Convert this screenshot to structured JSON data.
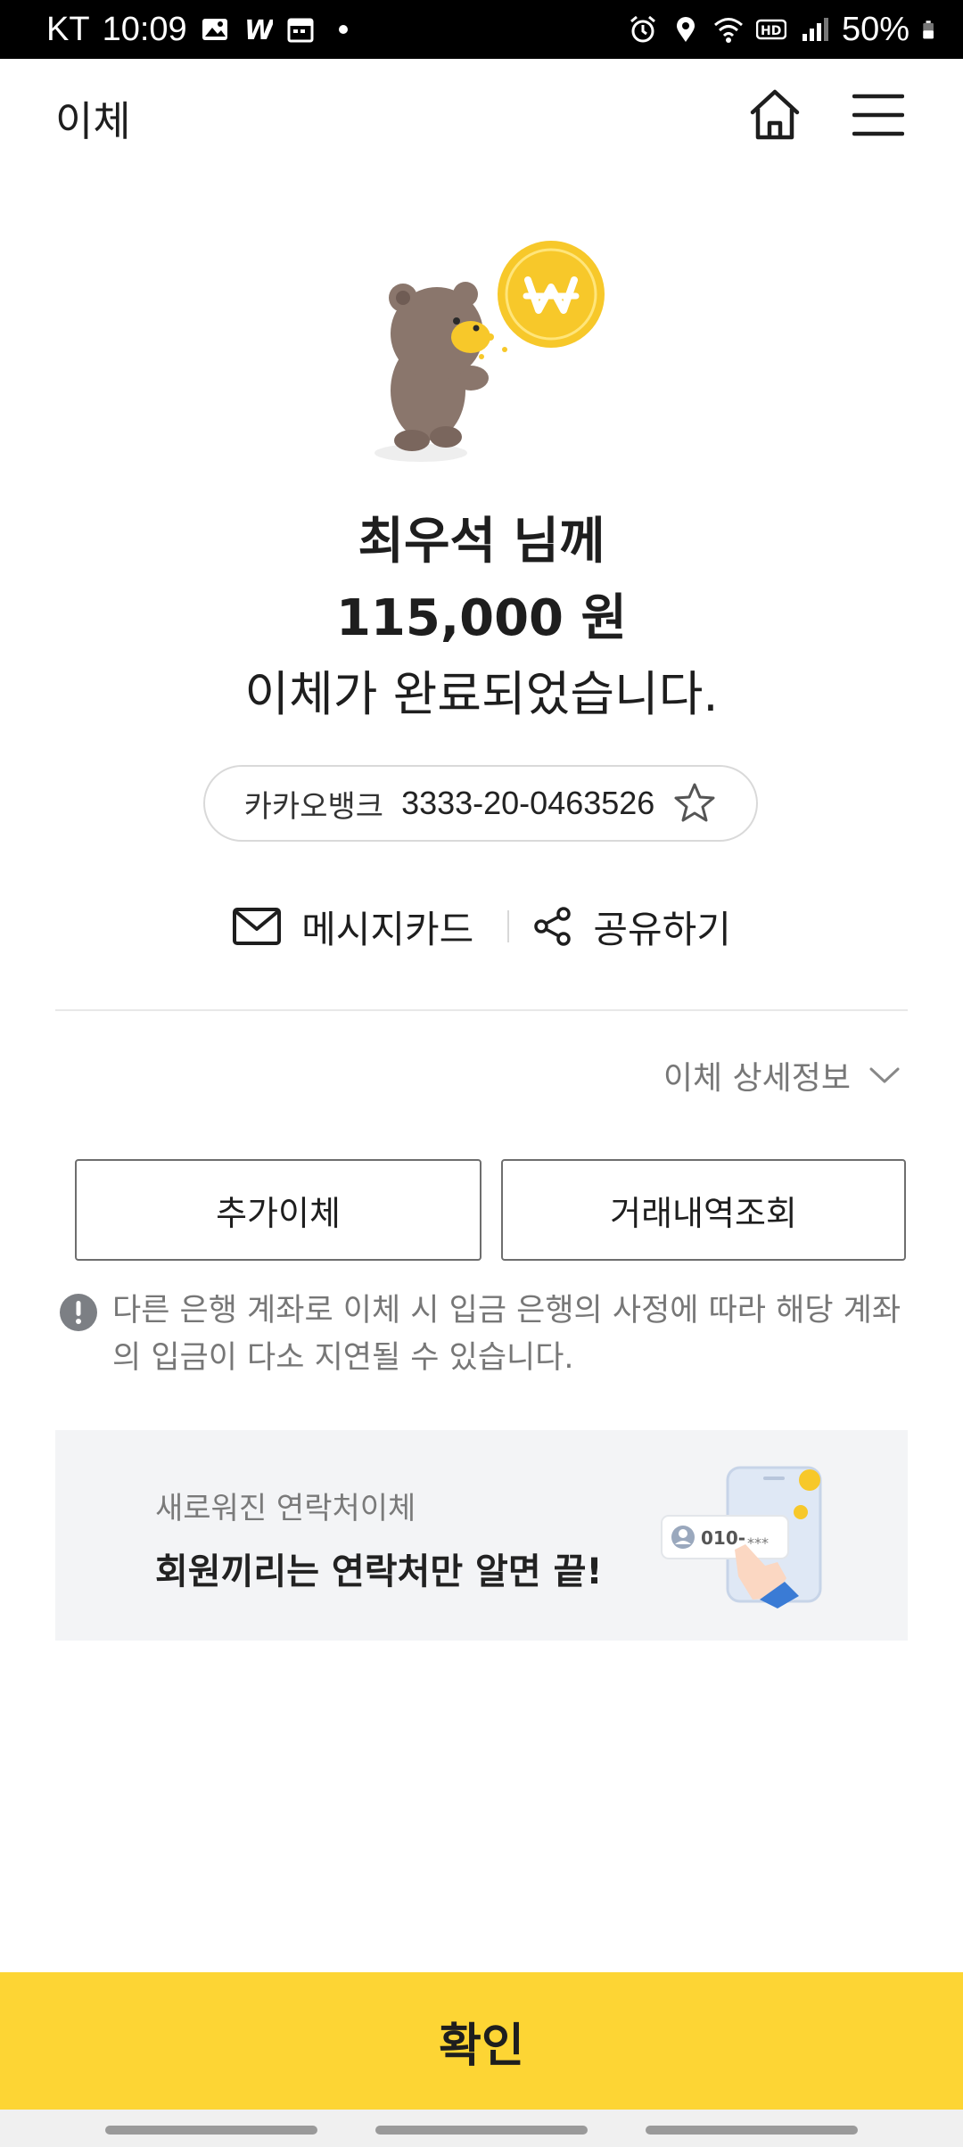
{
  "status_bar": {
    "carrier": "KT",
    "time": "10:09",
    "battery": "50%",
    "icons": [
      "gallery-icon",
      "w-app-icon",
      "calendar-icon",
      "dot-icon",
      "alarm-icon",
      "location-icon",
      "wifi-icon",
      "hd-icon",
      "signal-icon",
      "battery-icon"
    ]
  },
  "header": {
    "title": "이체",
    "home_icon": "home-icon",
    "menu_icon": "hamburger-menu-icon"
  },
  "result": {
    "recipient": "최우석 님께",
    "amount": "115,000 원",
    "message": "이체가 완료되었습니다."
  },
  "account": {
    "bank": "카카오뱅크",
    "number": "3333-20-0463526",
    "favorite_icon": "star-icon"
  },
  "actions": {
    "message_card": "메시지카드",
    "share": "공유하기"
  },
  "details_toggle": "이체 상세정보",
  "buttons": {
    "additional_transfer": "추가이체",
    "history": "거래내역조회"
  },
  "notice": {
    "text": "다른 은행 계좌로 이체 시 입금 은행의 사정에 따라 해당 계좌의 입금이 다소 지연될 수 있습니다."
  },
  "banner": {
    "subtitle": "새로워진 연락처이체",
    "title": "회원끼리는 연락처만 알면 끝!",
    "phone_label": "010-",
    "phone_mask": "***"
  },
  "confirm_button": "확인",
  "colors": {
    "accent": "#fdd534",
    "coin": "#f7c82a",
    "bear": "#8a766c"
  }
}
